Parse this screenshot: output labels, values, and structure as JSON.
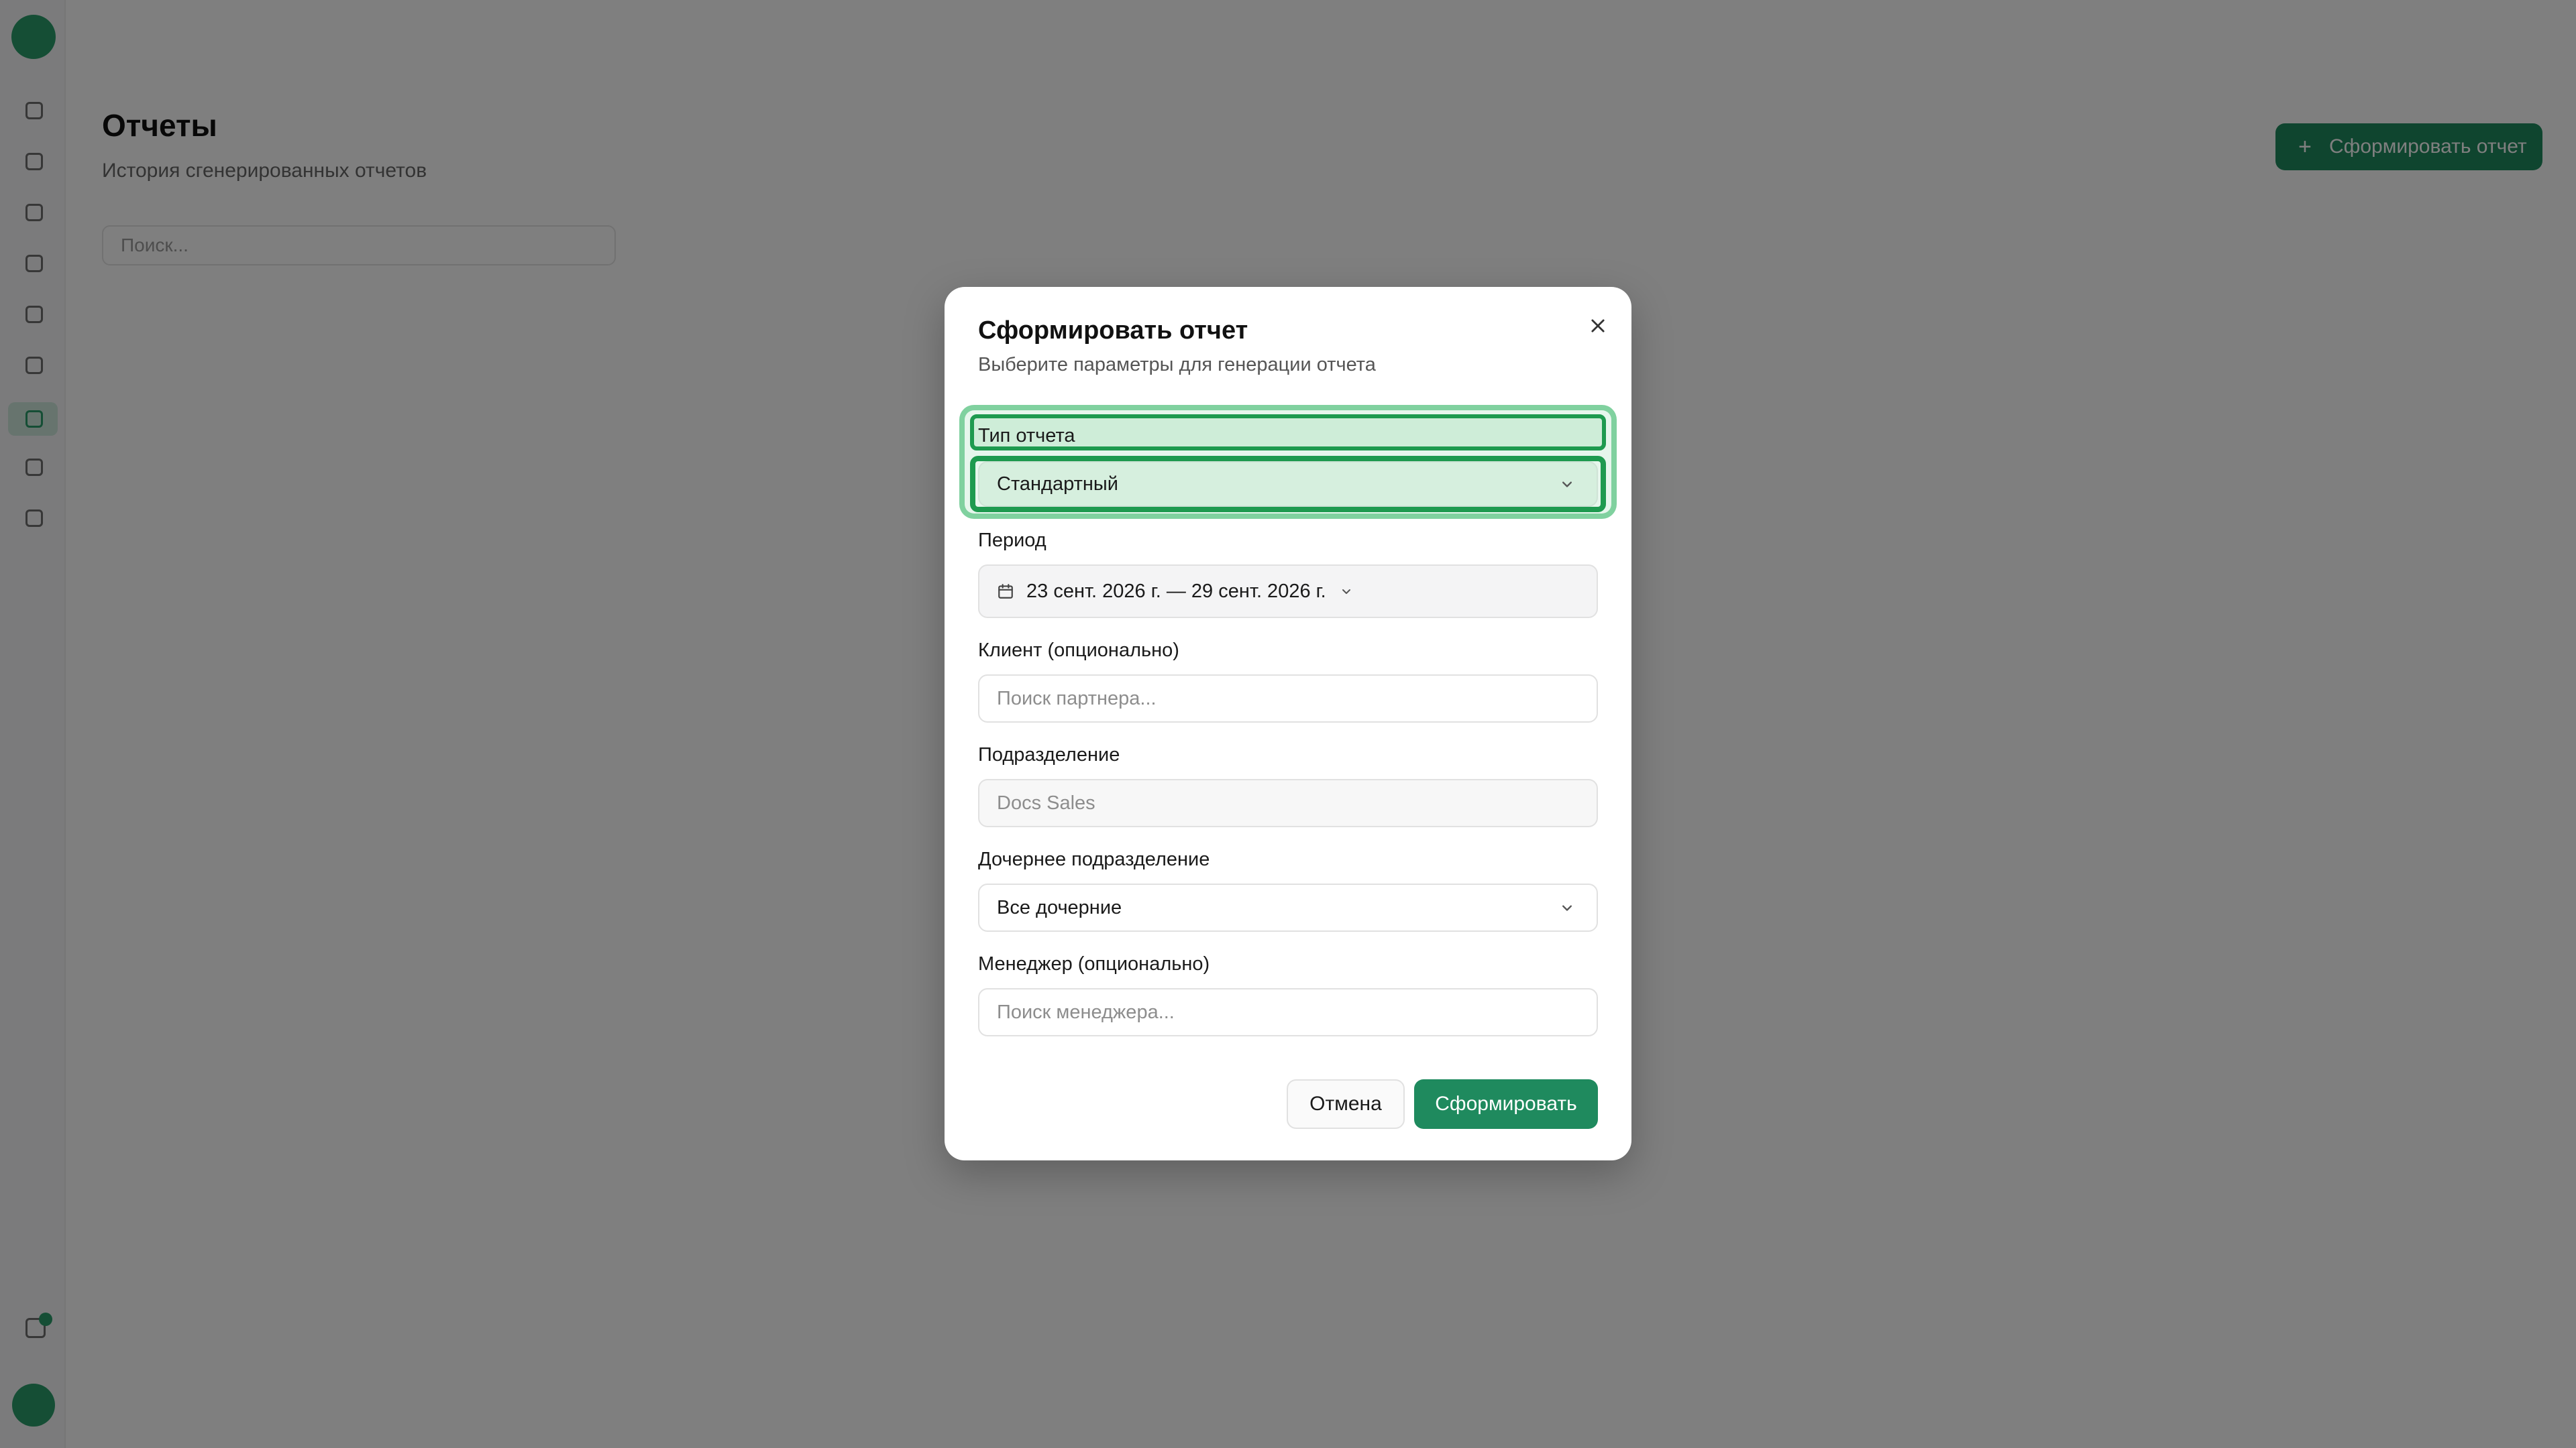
{
  "background": {
    "page_title": "Отчеты",
    "page_subtitle": "История сгенерированных отчетов",
    "search_placeholder": "Поиск...",
    "primary_button_label": "Сформировать отчет"
  },
  "modal": {
    "title": "Сформировать отчет",
    "description": "Выберите параметры для генерации отчета",
    "report_type": {
      "label": "Тип отчета",
      "value": "Стандартный"
    },
    "period": {
      "label": "Период",
      "value": "23 сент. 2026 г. — 29 сент. 2026 г."
    },
    "client": {
      "label": "Клиент (опционально)",
      "placeholder": "Поиск партнера..."
    },
    "department": {
      "label": "Подразделение",
      "value": "Docs Sales"
    },
    "sub_department": {
      "label": "Дочернее подразделение",
      "value": "Все дочерние"
    },
    "manager": {
      "label": "Менеджер (опционально)",
      "placeholder": "Поиск менеджера..."
    },
    "cancel_label": "Отмена",
    "submit_label": "Сформировать"
  },
  "colors": {
    "primary": "#1f8a5e",
    "highlight": "#1e9a4f",
    "overlay": "rgba(0,0,0,0.5)"
  },
  "icons": [
    "close-icon",
    "chevron-down-icon",
    "calendar-icon"
  ]
}
